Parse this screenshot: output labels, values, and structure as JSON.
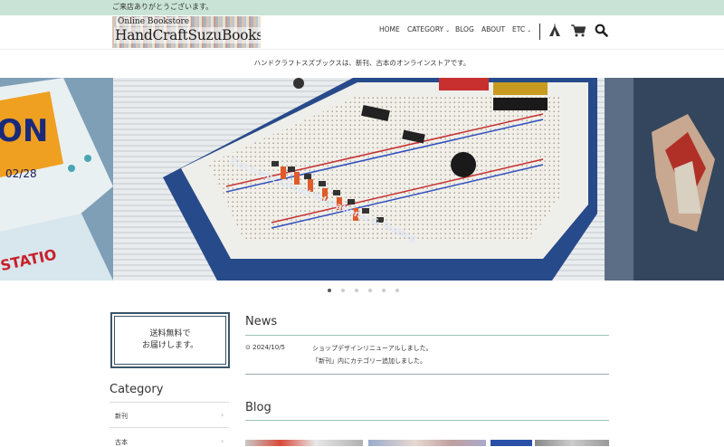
{
  "announcement": "ご来店ありがとうございます。",
  "logo": {
    "sub": "Online Bookstore",
    "main": "HandCraftSuzuBooks"
  },
  "nav": [
    {
      "label": "HOME",
      "dropdown": false
    },
    {
      "label": "CATEGORY",
      "dropdown": true
    },
    {
      "label": "BLOG",
      "dropdown": false
    },
    {
      "label": "ABOUT",
      "dropdown": false
    },
    {
      "label": "ETC",
      "dropdown": true
    }
  ],
  "icons": [
    "tent-icon",
    "cart-icon",
    "search-icon"
  ],
  "tagline": "ハンドクラフトスズブックスは、新刊、古本のオンラインストアです。",
  "slider": {
    "total": 6,
    "active": 1
  },
  "shipping": {
    "line1": "送料無料で",
    "line2": "お届けします。"
  },
  "sidebar": {
    "title": "Category",
    "items": [
      {
        "label": "新刊"
      },
      {
        "label": "古本"
      }
    ]
  },
  "news": {
    "title": "News",
    "items": [
      {
        "date": "2024/10/5",
        "lines": [
          "ショップデザインリニューアルしました。",
          "「新刊」内にカテゴリー追加しました。"
        ]
      }
    ]
  },
  "blog": {
    "title": "Blog"
  },
  "colors": {
    "announcement_bg": "#c9e4d6",
    "accent_line": "#9cc3b3",
    "box_border": "#3b5568"
  }
}
